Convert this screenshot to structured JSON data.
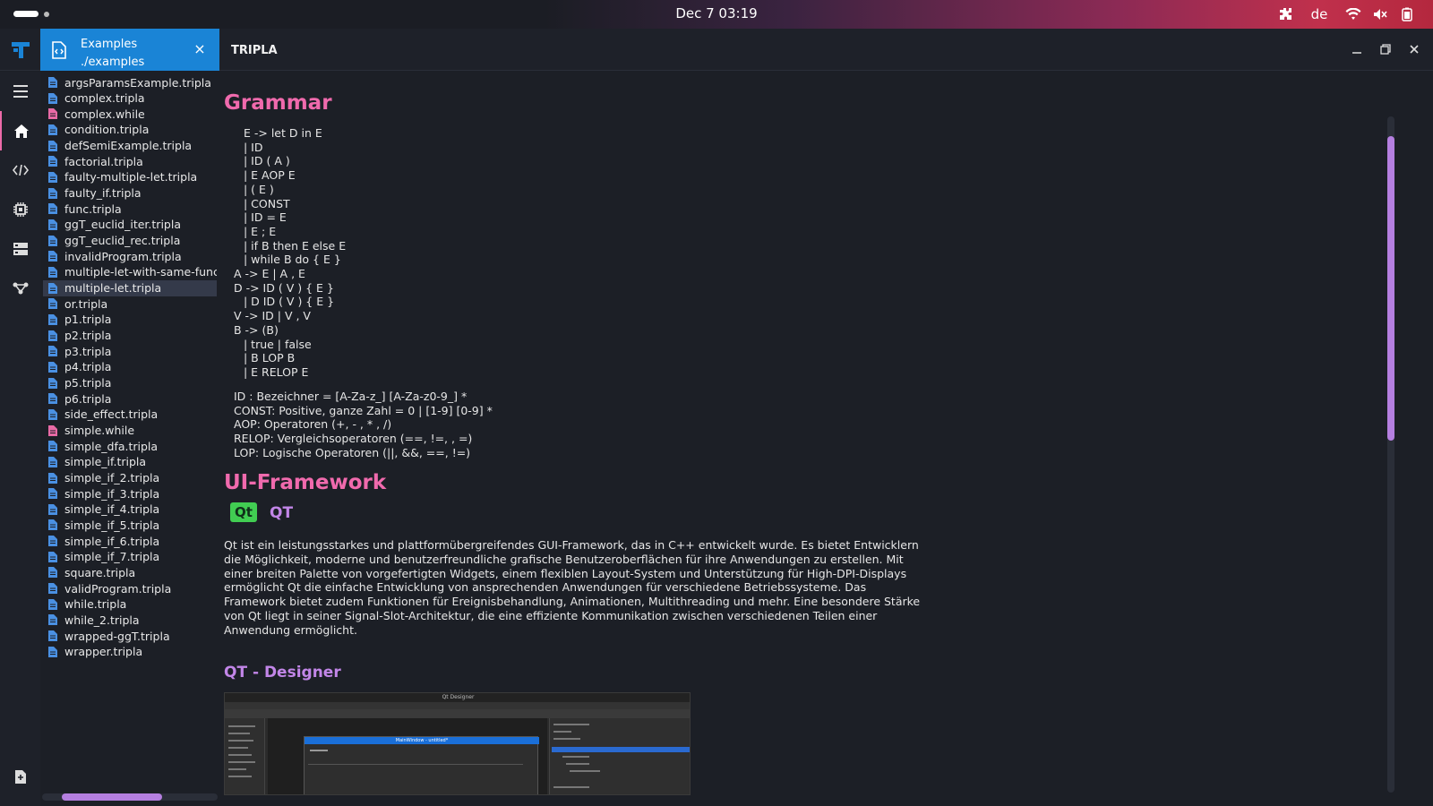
{
  "system_bar": {
    "clock": "Dec 7  03:19",
    "language": "de"
  },
  "tab": {
    "name": "Examples",
    "path": "./examples",
    "close": "×"
  },
  "window": {
    "title": "TRIPLA"
  },
  "files": [
    {
      "name": "argsParamsExample.tripla",
      "type": "tripla"
    },
    {
      "name": "complex.tripla",
      "type": "tripla"
    },
    {
      "name": "complex.while",
      "type": "while"
    },
    {
      "name": "condition.tripla",
      "type": "tripla"
    },
    {
      "name": "defSemiExample.tripla",
      "type": "tripla"
    },
    {
      "name": "factorial.tripla",
      "type": "tripla"
    },
    {
      "name": "faulty-multiple-let.tripla",
      "type": "tripla"
    },
    {
      "name": "faulty_if.tripla",
      "type": "tripla"
    },
    {
      "name": "func.tripla",
      "type": "tripla"
    },
    {
      "name": "ggT_euclid_iter.tripla",
      "type": "tripla"
    },
    {
      "name": "ggT_euclid_rec.tripla",
      "type": "tripla"
    },
    {
      "name": "invalidProgram.tripla",
      "type": "tripla"
    },
    {
      "name": "multiple-let-with-same-func-r",
      "type": "tripla"
    },
    {
      "name": "multiple-let.tripla",
      "type": "tripla",
      "selected": true
    },
    {
      "name": "or.tripla",
      "type": "tripla"
    },
    {
      "name": "p1.tripla",
      "type": "tripla"
    },
    {
      "name": "p2.tripla",
      "type": "tripla"
    },
    {
      "name": "p3.tripla",
      "type": "tripla"
    },
    {
      "name": "p4.tripla",
      "type": "tripla"
    },
    {
      "name": "p5.tripla",
      "type": "tripla"
    },
    {
      "name": "p6.tripla",
      "type": "tripla"
    },
    {
      "name": "side_effect.tripla",
      "type": "tripla"
    },
    {
      "name": "simple.while",
      "type": "while"
    },
    {
      "name": "simple_dfa.tripla",
      "type": "tripla"
    },
    {
      "name": "simple_if.tripla",
      "type": "tripla"
    },
    {
      "name": "simple_if_2.tripla",
      "type": "tripla"
    },
    {
      "name": "simple_if_3.tripla",
      "type": "tripla"
    },
    {
      "name": "simple_if_4.tripla",
      "type": "tripla"
    },
    {
      "name": "simple_if_5.tripla",
      "type": "tripla"
    },
    {
      "name": "simple_if_6.tripla",
      "type": "tripla"
    },
    {
      "name": "simple_if_7.tripla",
      "type": "tripla"
    },
    {
      "name": "square.tripla",
      "type": "tripla"
    },
    {
      "name": "validProgram.tripla",
      "type": "tripla"
    },
    {
      "name": "while.tripla",
      "type": "tripla"
    },
    {
      "name": "while_2.tripla",
      "type": "tripla"
    },
    {
      "name": "wrapped-ggT.tripla",
      "type": "tripla"
    },
    {
      "name": "wrapper.tripla",
      "type": "tripla"
    }
  ],
  "content": {
    "grammar_heading": "Grammar",
    "grammar_lines": [
      {
        "text": "E -> let D in E",
        "indent": 2
      },
      {
        "text": "| ID",
        "indent": 2
      },
      {
        "text": "| ID ( A )",
        "indent": 2
      },
      {
        "text": "| E AOP E",
        "indent": 2
      },
      {
        "text": "| ( E )",
        "indent": 2
      },
      {
        "text": "| CONST",
        "indent": 2
      },
      {
        "text": "| ID = E",
        "indent": 2
      },
      {
        "text": "| E ; E",
        "indent": 2
      },
      {
        "text": "| if B then E else E",
        "indent": 2
      },
      {
        "text": "| while B do { E }",
        "indent": 2
      },
      {
        "text": "A -> E | A , E",
        "indent": 1
      },
      {
        "text": "D -> ID ( V ) { E }",
        "indent": 1
      },
      {
        "text": "| D ID ( V ) { E }",
        "indent": 2
      },
      {
        "text": "V -> ID | V , V",
        "indent": 1
      },
      {
        "text": "B -> (B)",
        "indent": 1
      },
      {
        "text": "| true | false",
        "indent": 2
      },
      {
        "text": "| B LOP B",
        "indent": 2
      },
      {
        "text": "| E RELOP E",
        "indent": 2
      }
    ],
    "definitions": [
      "ID : Bezeichner = [A-Za-z_] [A-Za-z0-9_] *",
      "CONST: Positive, ganze Zahl = 0 | [1-9] [0-9] *",
      "AOP: Operatoren (+, - , * , /)",
      "RELOP: Vergleichsoperatoren (==, !=, , =)",
      "LOP: Logische Operatoren (||, &&, ==, !=)"
    ],
    "ui_heading": "UI-Framework",
    "qt_logo": "Qt",
    "qt_label": "QT",
    "qt_paragraph": "Qt ist ein leistungsstarkes und plattformübergreifendes GUI-Framework, das in C++ entwickelt wurde. Es bietet Entwicklern die Möglichkeit, moderne und benutzerfreundliche grafische Benutzeroberflächen für ihre Anwendungen zu erstellen. Mit einer breiten Palette von vorgefertigten Widgets, einem flexiblen Layout-System und Unterstützung für High-DPI-Displays ermöglicht Qt die einfache Entwicklung von ansprechenden Anwendungen für verschiedene Betriebssysteme. Das Framework bietet zudem Funktionen für Ereignisbehandlung, Animationen, Multithreading und mehr. Eine besondere Stärke von Qt liegt in seiner Signal-Slot-Architektur, die eine effiziente Kommunikation zwischen verschiedenen Teilen einer Anwendung ermöglicht.",
    "designer_heading": "QT - Designer",
    "designer_window_title": "Qt Designer",
    "designer_form_title": "MainWindow - untitled*"
  },
  "icons": {
    "app_logo": "tripla-logo-icon",
    "menu": "hamburger-menu-icon",
    "home": "home-icon",
    "code": "code-icon",
    "chip": "chip-icon",
    "storage": "storage-icon",
    "graph": "graph-icon",
    "new_file": "new-file-icon",
    "extensions": "puzzle-icon",
    "wifi": "wifi-icon",
    "volume": "volume-muted-icon",
    "battery": "battery-icon"
  },
  "colors": {
    "accent_blue": "#1a84d6",
    "heading_pink": "#f06aad",
    "heading_purple": "#c286e8",
    "tripla_file": "#4a90e2",
    "while_file": "#e86aa5",
    "qt_green": "#41cd52",
    "scrollbar": "#b57fe0"
  }
}
